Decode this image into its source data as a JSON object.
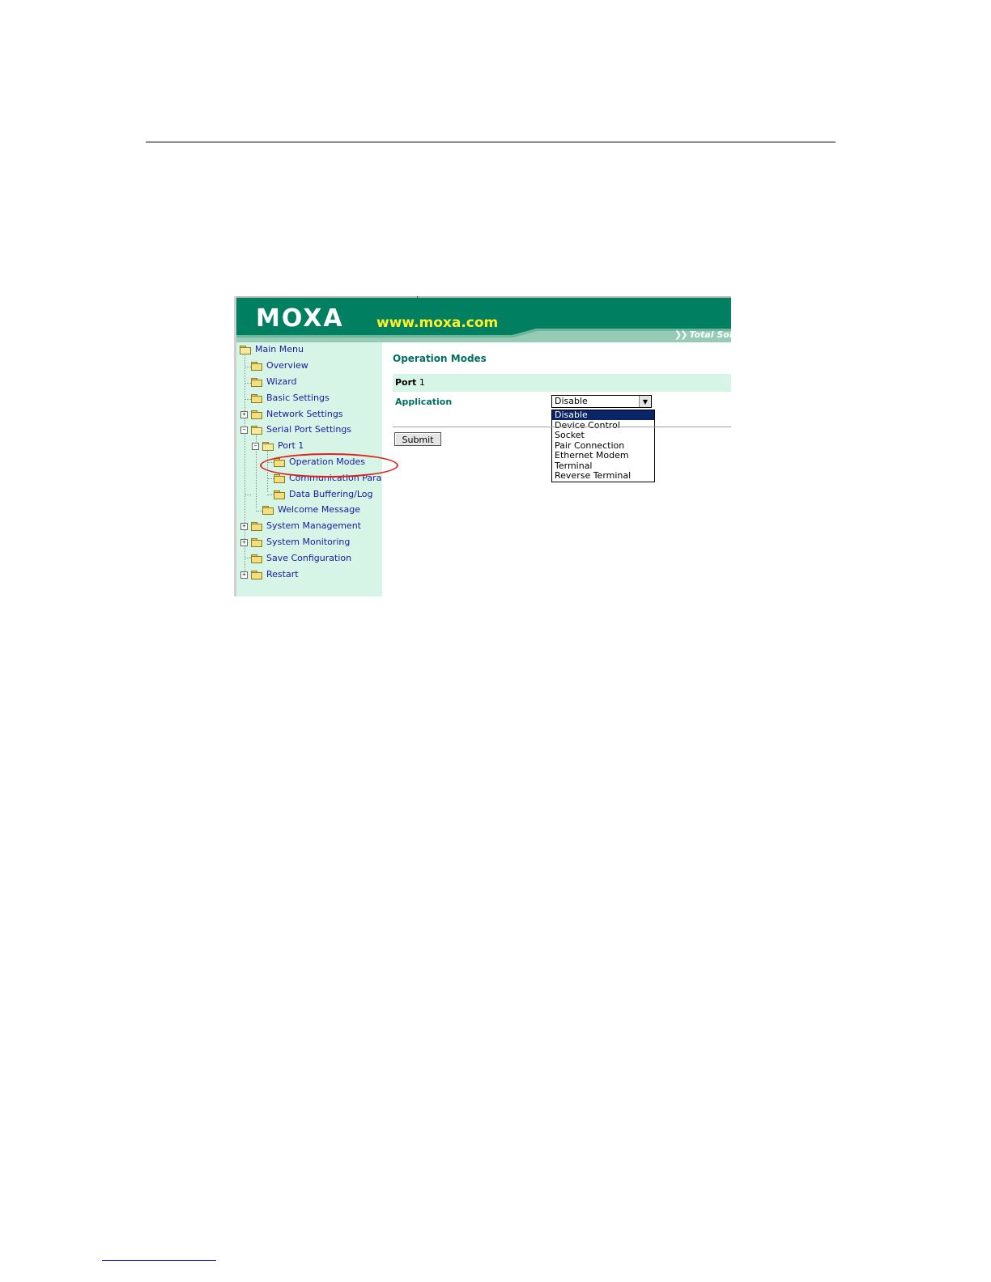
{
  "header": {
    "logo": "MOXA",
    "url": "www.moxa.com",
    "tagline": "Total Sol",
    "brand_color": "#008060",
    "url_color": "#ffef2a"
  },
  "sidebar": {
    "items": [
      {
        "label": "Main Menu"
      },
      {
        "label": "Overview"
      },
      {
        "label": "Wizard"
      },
      {
        "label": "Basic Settings"
      },
      {
        "label": "Network Settings"
      },
      {
        "label": "Serial Port Settings"
      },
      {
        "label": "Port 1"
      },
      {
        "label": "Operation Modes"
      },
      {
        "label": "Communication Para"
      },
      {
        "label": "Data Buffering/Log"
      },
      {
        "label": "Welcome Message"
      },
      {
        "label": "System Management"
      },
      {
        "label": "System Monitoring"
      },
      {
        "label": "Save Configuration"
      },
      {
        "label": "Restart"
      }
    ],
    "highlighted_item": "Operation Modes",
    "background": "#d6f5e6"
  },
  "main": {
    "title": "Operation Modes",
    "port_prefix": "Port",
    "port_number": "1",
    "application_label": "Application",
    "application_value": "Disable",
    "application_options": [
      "Disable",
      "Device Control",
      "Socket",
      "Pair Connection",
      "Ethernet Modem",
      "Terminal",
      "Reverse Terminal"
    ],
    "submit_label": "Submit"
  }
}
